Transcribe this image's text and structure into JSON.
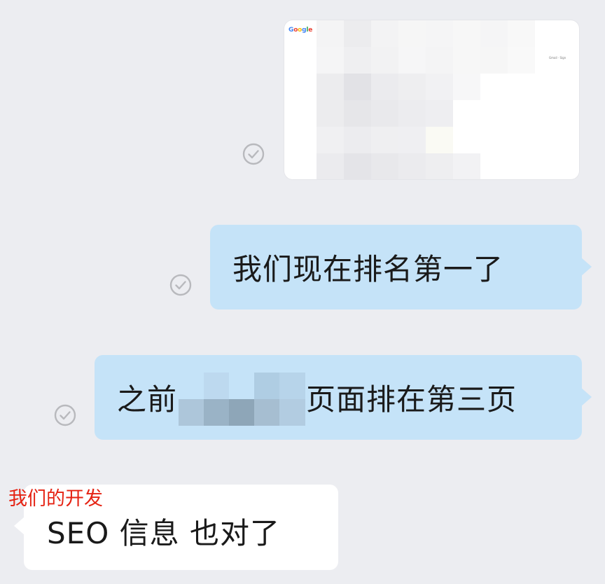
{
  "messages": [
    {
      "type": "image",
      "direction": "outgoing",
      "status": "read",
      "image": {
        "logo_text": "Google",
        "top_links": "Gmail · Sign",
        "blurred": true
      }
    },
    {
      "type": "text",
      "direction": "outgoing",
      "status": "read",
      "text": "我们现在排名第一了"
    },
    {
      "type": "text",
      "direction": "outgoing",
      "status": "read",
      "text_before": "之前",
      "redacted": true,
      "text_after": "页面排在第三页"
    },
    {
      "type": "text",
      "direction": "incoming",
      "annotation": "我们的开发",
      "text": "SEO 信息 也对了"
    }
  ],
  "colors": {
    "background": "#ecedf1",
    "outgoing_bubble": "#c5e3f8",
    "incoming_bubble": "#ffffff",
    "annotation": "#e52313",
    "check_icon": "#b8b9bd"
  },
  "icons": [
    "read-check-icon",
    "google-logo"
  ]
}
